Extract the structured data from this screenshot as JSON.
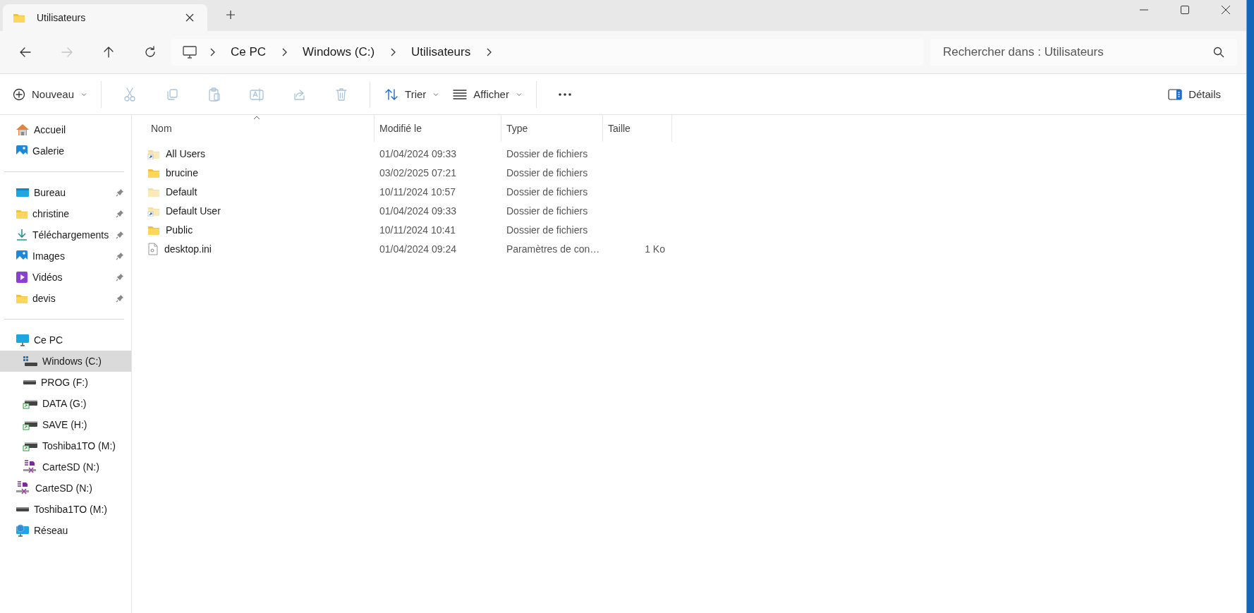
{
  "tabs": [
    {
      "title": "Utilisateurs",
      "selected": true
    }
  ],
  "nav_buttons": [
    {
      "kind": "back",
      "disabled": false
    },
    {
      "kind": "forward",
      "disabled": true
    },
    {
      "kind": "up",
      "disabled": false
    },
    {
      "kind": "refresh",
      "disabled": false
    }
  ],
  "breadcrumb": [
    "Ce PC",
    "Windows (C:)",
    "Utilisateurs"
  ],
  "search": {
    "placeholder": "Rechercher dans : Utilisateurs"
  },
  "toolbar": [
    {
      "kind": "new",
      "label": "Nouveau",
      "disabled": false
    },
    {
      "kind": "cut",
      "disabled": true
    },
    {
      "kind": "copy",
      "disabled": true
    },
    {
      "kind": "paste",
      "disabled": true
    },
    {
      "kind": "rename",
      "disabled": true
    },
    {
      "kind": "share",
      "disabled": true
    },
    {
      "kind": "delete",
      "disabled": true
    },
    {
      "kind": "sort",
      "label": "Trier",
      "disabled": false
    },
    {
      "kind": "view",
      "label": "Afficher",
      "disabled": false
    },
    {
      "kind": "more",
      "disabled": false
    }
  ],
  "details_button": "Détails",
  "sidebar": [
    [
      {
        "label": "Accueil",
        "kind": "home",
        "pinned": false,
        "selected": false
      },
      {
        "label": "Galerie",
        "kind": "gallery",
        "pinned": false,
        "selected": false
      }
    ],
    [
      {
        "label": "Bureau",
        "kind": "desktop",
        "pinned": true,
        "selected": false
      },
      {
        "label": "christine",
        "kind": "folder",
        "pinned": true,
        "selected": false
      },
      {
        "label": "Téléchargements",
        "kind": "download",
        "pinned": true,
        "selected": false
      },
      {
        "label": "Images",
        "kind": "images",
        "pinned": true,
        "selected": false
      },
      {
        "label": "Vidéos",
        "kind": "videos",
        "pinned": true,
        "selected": false
      },
      {
        "label": "devis",
        "kind": "folder",
        "pinned": true,
        "selected": false
      }
    ],
    [
      {
        "label": "Ce PC",
        "kind": "pc",
        "pinned": false,
        "selected": false,
        "children": [
          {
            "label": "Windows (C:)",
            "kind": "drive-win",
            "pinned": false,
            "selected": true
          },
          {
            "label": "PROG (F:)",
            "kind": "drive",
            "pinned": false,
            "selected": false
          },
          {
            "label": "DATA (G:)",
            "kind": "drive-net",
            "pinned": false,
            "selected": false
          },
          {
            "label": "SAVE (H:)",
            "kind": "drive-net",
            "pinned": false,
            "selected": false
          },
          {
            "label": "Toshiba1TO (M:)",
            "kind": "drive-net",
            "pinned": false,
            "selected": false
          },
          {
            "label": "CarteSD (N:)",
            "kind": "sd",
            "pinned": false,
            "selected": false
          }
        ]
      },
      {
        "label": "CarteSD (N:)",
        "kind": "sd",
        "pinned": false,
        "selected": false
      },
      {
        "label": "Toshiba1TO (M:)",
        "kind": "drive",
        "pinned": false,
        "selected": false
      },
      {
        "label": "Réseau",
        "kind": "network",
        "pinned": false,
        "selected": false
      }
    ]
  ],
  "table": {
    "columns": [
      {
        "label": "Nom",
        "sorted": true
      },
      {
        "label": "Modifié le",
        "sorted": false
      },
      {
        "label": "Type",
        "sorted": false
      },
      {
        "label": "Taille",
        "sorted": false
      }
    ],
    "rows": [
      {
        "kind": "shortcut",
        "name": "All Users",
        "modified": "01/04/2024 09:33",
        "type": "Dossier de fichiers"
      },
      {
        "kind": "folder",
        "name": "brucine",
        "modified": "03/02/2025 07:21",
        "type": "Dossier de fichiers"
      },
      {
        "kind": "hidden",
        "name": "Default",
        "modified": "10/11/2024 10:57",
        "type": "Dossier de fichiers"
      },
      {
        "kind": "shortcut",
        "name": "Default User",
        "modified": "01/04/2024 09:33",
        "type": "Dossier de fichiers"
      },
      {
        "kind": "folder",
        "name": "Public",
        "modified": "10/11/2024 10:41",
        "type": "Dossier de fichiers"
      },
      {
        "kind": "file",
        "name": "desktop.ini",
        "modified": "01/04/2024 09:24",
        "type": "Paramètres de con…",
        "size": "1 Ko"
      }
    ]
  }
}
